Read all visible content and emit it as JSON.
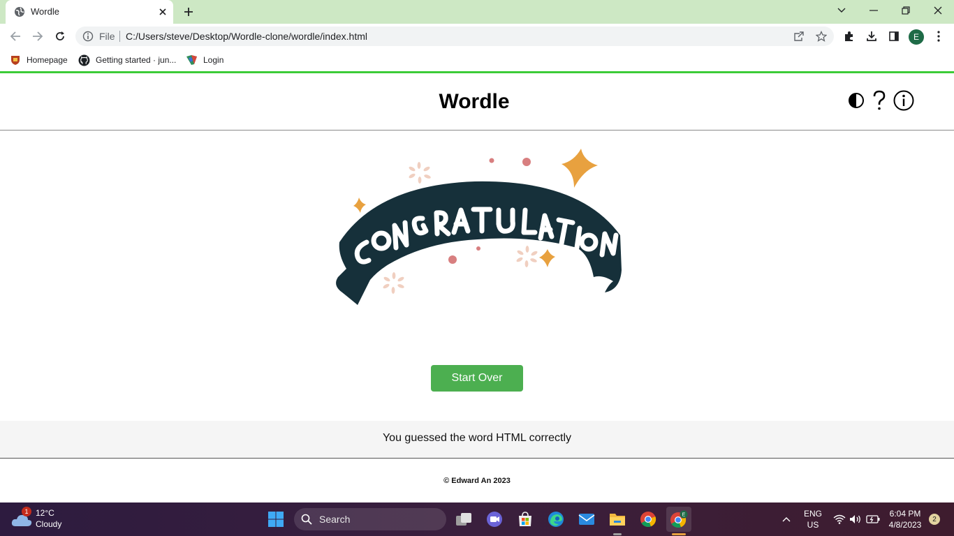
{
  "browser": {
    "tab_title": "Wordle",
    "omnibox_prefix": "File",
    "url": "C:/Users/steve/Desktop/Wordle-clone/wordle/index.html",
    "profile_initial": "E",
    "bookmarks": [
      "Homepage",
      "Getting started · jun...",
      "Login"
    ]
  },
  "app": {
    "title": "Wordle",
    "header_icons": [
      "contrast-icon",
      "help-icon",
      "info-icon"
    ],
    "congrats_image_text": "CONGRATULATIONS",
    "start_over_label": "Start Over",
    "message": "You guessed the word HTML correctly",
    "footer": "© Edward An 2023",
    "accent_color": "#4caf50"
  },
  "taskbar": {
    "weather_badge": "1",
    "weather_temp": "12°C",
    "weather_condition": "Cloudy",
    "search_label": "Search",
    "language_line1": "ENG",
    "language_line2": "US",
    "time": "6:04 PM",
    "date": "4/8/2023",
    "notification_count": "2"
  }
}
